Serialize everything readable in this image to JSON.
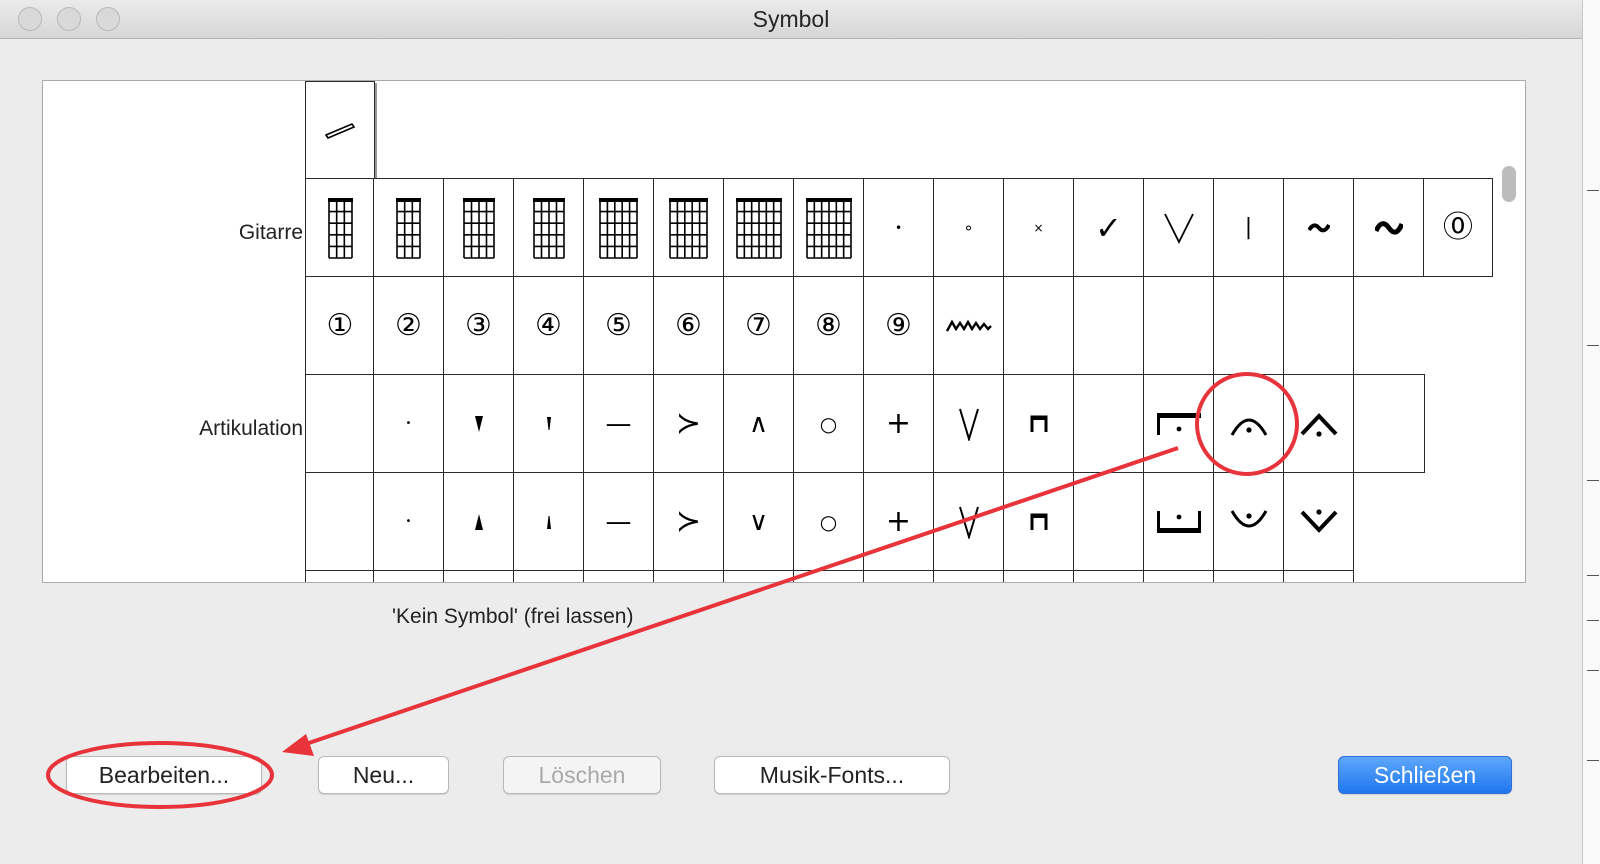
{
  "window": {
    "title": "Symbol"
  },
  "rows": [
    {
      "label": ""
    },
    {
      "label": "Gitarre"
    },
    {
      "label": ""
    },
    {
      "label": "Artikulation"
    },
    {
      "label": ""
    }
  ],
  "glyphs": {
    "circled": [
      "⓪",
      "①",
      "②",
      "③",
      "④",
      "⑤",
      "⑥",
      "⑦",
      "⑧",
      "⑨"
    ],
    "dot": "•",
    "small_circle": "∘",
    "small_x": "×",
    "check": "✓",
    "plus": "+",
    "minus": "—",
    "accent": "≻",
    "circle": "○",
    "caret_up": "∧",
    "caret_down": "∨",
    "bar": "|"
  },
  "status_text": "'Kein Symbol' (frei lassen)",
  "buttons": {
    "edit": "Bearbeiten...",
    "new": "Neu...",
    "delete": "Löschen",
    "music_fonts": "Musik-Fonts...",
    "close": "Schließen"
  },
  "colors": {
    "annotation": "#e8333a",
    "primary_button": "#1f76ee"
  },
  "icons": [
    "close-window-icon",
    "minimize-window-icon",
    "zoom-window-icon",
    "chord-frame-icon",
    "annotation-arrow-icon"
  ]
}
